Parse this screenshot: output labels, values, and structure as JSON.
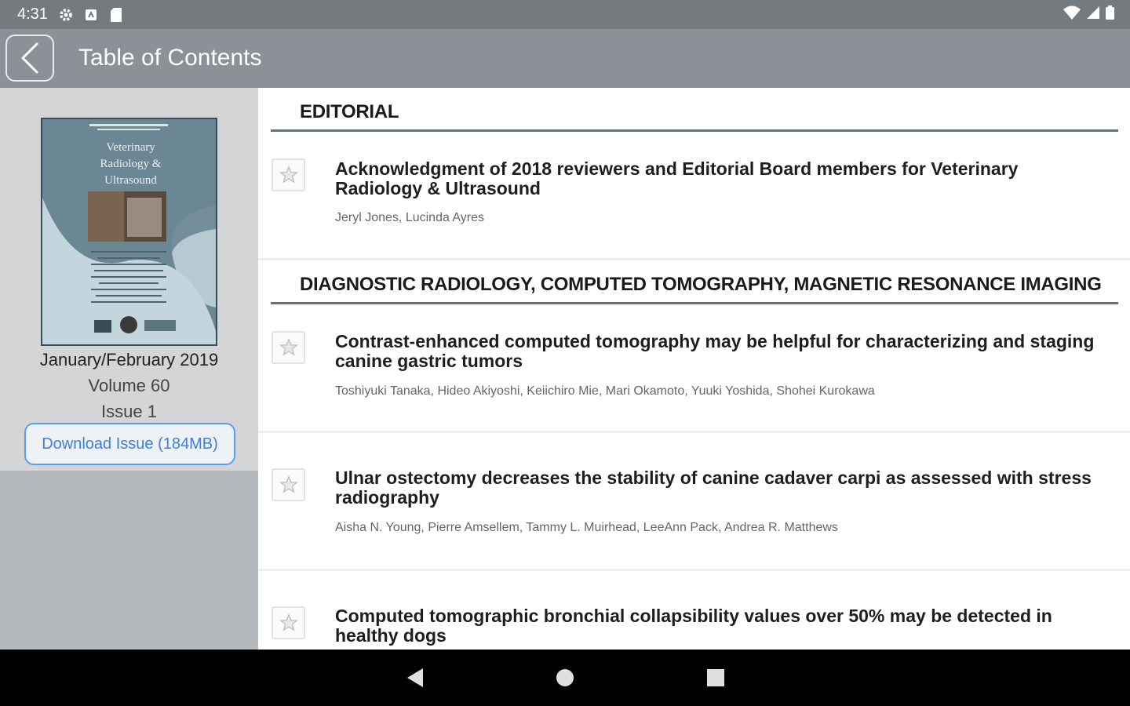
{
  "status_bar": {
    "time": "4:31"
  },
  "app_bar": {
    "title": "Table of Contents"
  },
  "issue": {
    "cover_title": [
      "Veterinary",
      "Radiology &",
      "Ultrasound"
    ],
    "date": "January/February 2019",
    "volume": "Volume 60",
    "issue": "Issue 1",
    "download_label": "Download Issue (184MB)"
  },
  "sections": [
    {
      "title": "EDITORIAL",
      "articles": [
        {
          "title": "Acknowledgment of 2018 reviewers and Editorial Board members for Veterinary Radiology & Ultrasound",
          "authors": "Jeryl Jones, Lucinda Ayres"
        }
      ]
    },
    {
      "title": "DIAGNOSTIC RADIOLOGY, COMPUTED TOMOGRAPHY, MAGNETIC RESONANCE IMAGING",
      "articles": [
        {
          "title": "Contrast-enhanced computed tomography may be helpful for characterizing and staging canine gastric tumors",
          "authors": "Toshiyuki Tanaka, Hideo Akiyoshi, Keiichiro Mie, Mari Okamoto, Yuuki Yoshida, Shohei Kurokawa"
        },
        {
          "title": "Ulnar ostectomy decreases the stability of canine cadaver carpi as assessed with stress radiography",
          "authors": "Aisha N. Young, Pierre Amsellem, Tammy L. Muirhead, LeeAnn Pack, Andrea R. Matthews"
        },
        {
          "title": "Computed tomographic bronchial collapsibility values over 50% may be detected in healthy dogs",
          "authors": ""
        }
      ]
    }
  ],
  "colors": {
    "status_bar": "#757a7f",
    "app_bar": "#8b9196",
    "accent_link": "#3c7fe0",
    "section_rule": "#5f7378"
  }
}
